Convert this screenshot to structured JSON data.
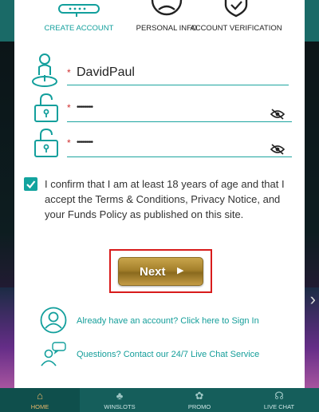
{
  "stepper": {
    "steps": [
      {
        "label": "CREATE ACCOUNT",
        "active": true
      },
      {
        "label": "PERSONAL INFO",
        "active": false
      },
      {
        "label": "ACCOUNT VERIFICATION",
        "active": false
      }
    ]
  },
  "form": {
    "username": {
      "required_mark": "*",
      "value": "DavidPaul"
    },
    "password": {
      "required_mark": "*",
      "value": "••••••••"
    },
    "confirm_password": {
      "required_mark": "*",
      "value": "••••••••"
    }
  },
  "consent": {
    "checked": true,
    "text": "I confirm that I am at least 18 years of age and that I accept the Terms & Conditions, Privacy Notice, and your Funds Policy as published on this site."
  },
  "next_button": {
    "label": "Next",
    "arrow": "▶"
  },
  "links": {
    "sign_in": "Already have an account? Click here to Sign In",
    "live_chat": "Questions? Contact our 24/7 Live Chat Service"
  },
  "bottom_nav": {
    "items": [
      {
        "label": "HOME",
        "active": true
      },
      {
        "label": "WINSLOTS",
        "active": false
      },
      {
        "label": "PROMO",
        "active": false
      },
      {
        "label": "LIVE CHAT",
        "active": false
      }
    ]
  },
  "colors": {
    "accent": "#129f9c",
    "required": "#d03030",
    "next_button_gold": "#a4802b",
    "highlight_border": "#d81b1b"
  }
}
